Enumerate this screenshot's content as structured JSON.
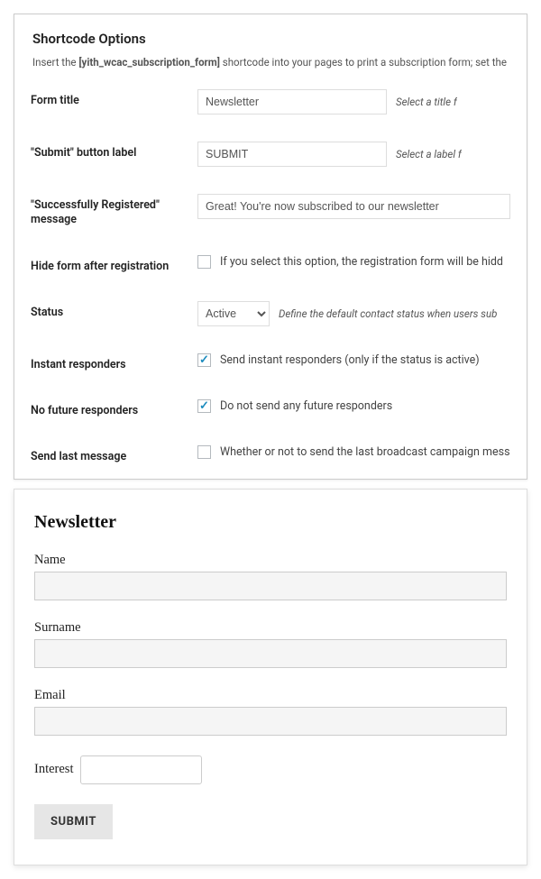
{
  "options": {
    "title": "Shortcode Options",
    "desc_pre": "Insert the ",
    "desc_code": "[yith_wcac_subscription_form]",
    "desc_post": " shortcode into your pages to print a subscription form; set the op",
    "rows": {
      "form_title": {
        "label": "Form title",
        "value": "Newsletter",
        "hint": "Select a title f"
      },
      "submit_label": {
        "label": "\"Submit\" button label",
        "value": "SUBMIT",
        "hint": "Select a label f"
      },
      "success_msg": {
        "label": "\"Successfully Registered\" message",
        "value": "Great! You're now subscribed to our newsletter"
      },
      "hide_form": {
        "label": "Hide form after registration",
        "text": "If you select this option, the registration form will be hidd"
      },
      "status": {
        "label": "Status",
        "value": "Active",
        "hint": "Define the default contact status when users sub"
      },
      "instant": {
        "label": "Instant responders",
        "text": "Send instant responders (only if the status is active)"
      },
      "no_future": {
        "label": "No future responders",
        "text": "Do not send any future responders"
      },
      "send_last": {
        "label": "Send last message",
        "text": "Whether or not to send the last broadcast campaign mess"
      }
    }
  },
  "form": {
    "title": "Newsletter",
    "name_label": "Name",
    "surname_label": "Surname",
    "email_label": "Email",
    "interest_label": "Interest",
    "submit_label": "SUBMIT"
  }
}
